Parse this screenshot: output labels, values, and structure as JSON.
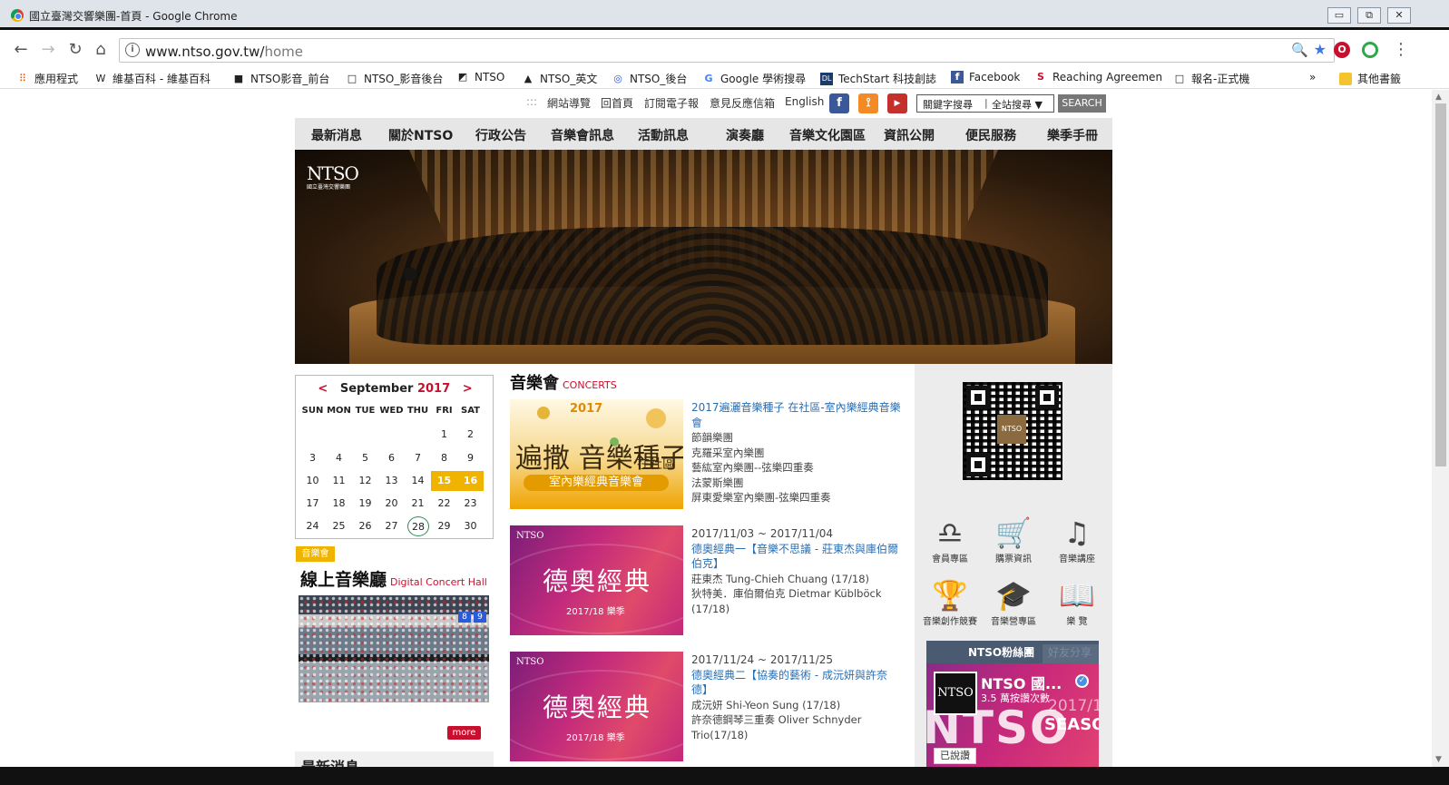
{
  "window": {
    "title": "國立臺灣交響樂團-首頁 - Google Chrome",
    "controls": {
      "minimize": "▭",
      "restore": "⧉",
      "close": "✕"
    }
  },
  "toolbar": {
    "back": "←",
    "forward": "→",
    "reload": "↻",
    "home": "⌂",
    "url_host": "www.ntso.gov.tw/",
    "url_path": "home",
    "info_icon": "i",
    "zoom_icon": "🔍",
    "star_icon": "★",
    "menu_icon": "⋮"
  },
  "bookmarks": {
    "apps": "應用程式",
    "items": [
      {
        "icon": "W",
        "label": "維基百科 - 維基百科"
      },
      {
        "icon": "■",
        "label": "NTSO影音_前台"
      },
      {
        "icon": "□",
        "label": "NTSO_影音後台"
      },
      {
        "icon": "◩",
        "label": "NTSO"
      },
      {
        "icon": "▲",
        "label": "NTSO_英文"
      },
      {
        "icon": "◎",
        "label": "NTSO_後台"
      },
      {
        "icon": "G",
        "label": "Google 學術搜尋"
      },
      {
        "icon": "DL",
        "label": "TechStart 科技創誌"
      },
      {
        "icon": "f",
        "label": "Facebook"
      },
      {
        "icon": "S",
        "label": "Reaching Agreemen"
      },
      {
        "icon": "□",
        "label": "報名-正式機"
      }
    ],
    "overflow": "»",
    "other": "其他書籤"
  },
  "site": {
    "util_links": [
      "網站導覽",
      "回首頁",
      "訂閱電子報",
      "意見反應信箱",
      "English"
    ],
    "util_sep": ":::",
    "search_scope_left": "關鍵字搜尋",
    "search_scope_right": "全站搜尋 ▼",
    "search_button": "SEARCH",
    "nav": [
      "最新消息",
      "關於NTSO",
      "行政公告",
      "音樂會訊息",
      "活動訊息",
      "演奏廳",
      "音樂文化園區",
      "資訊公開",
      "便民服務",
      "樂季手冊"
    ],
    "hero_logo": "NTSO",
    "hero_logo_sub": "國立臺灣交響樂團"
  },
  "calendar": {
    "prev": "<",
    "month": "September",
    "year": "2017",
    "next": ">",
    "weekdays": [
      "SUN",
      "MON",
      "TUE",
      "WED",
      "THU",
      "FRI",
      "SAT"
    ],
    "weeks": [
      [
        "",
        "",
        "",
        "",
        "",
        "1",
        "2"
      ],
      [
        "3",
        "4",
        "5",
        "6",
        "7",
        "8",
        "9"
      ],
      [
        "10",
        "11",
        "12",
        "13",
        "14",
        "15",
        "16"
      ],
      [
        "17",
        "18",
        "19",
        "20",
        "21",
        "22",
        "23"
      ],
      [
        "24",
        "25",
        "26",
        "27",
        "28",
        "29",
        "30"
      ]
    ],
    "event_days": [
      "15",
      "16"
    ],
    "today": "28"
  },
  "online": {
    "badge": "音樂會",
    "title": "線上音樂廳",
    "title_en": "Digital Concert Hall",
    "more": "more",
    "screen1": "8",
    "screen2": "9"
  },
  "news_strip": "最新消息",
  "concerts": {
    "title": "音樂會",
    "title_en": "CONCERTS",
    "items": [
      {
        "title": "2017遍灑音樂種子 在社區-室內樂經典音樂會",
        "lines": [
          "節韻樂團",
          "克羅采室內樂團",
          "藝紘室內樂團--弦樂四重奏",
          "法蒙斯樂團",
          "屏東愛樂室內樂團-弦樂四重奏"
        ],
        "image": {
          "top": "2017",
          "main": "遍撒 音樂種子",
          "side": "在社區",
          "banner": "室內樂經典音樂會"
        }
      },
      {
        "date": "2017/11/03 ~ 2017/11/04",
        "title": "德奧經典一【音樂不思議 - 莊東杰與庫伯爾伯克】",
        "lines": [
          "莊東杰 Tung-Chieh Chuang (17/18)",
          "狄特美．庫伯爾伯克 Dietmar Küblböck (17/18)"
        ],
        "image": {
          "brand": "NTSO",
          "main": "德奧經典",
          "season": "2017/18 樂季"
        }
      },
      {
        "date": "2017/11/24 ~ 2017/11/25",
        "title": "德奧經典二【協奏的藝術 - 成沅妍與許奈德】",
        "lines": [
          "成沅妍 Shi-Yeon Sung (17/18)",
          "許奈德鋼琴三重奏 Oliver Schnyder Trio(17/18)"
        ],
        "image": {
          "brand": "NTSO",
          "main": "德奧經典",
          "season": "2017/18 樂季"
        }
      }
    ]
  },
  "services": [
    {
      "icon": "members-icon",
      "glyph": "♎",
      "label": "會員專區"
    },
    {
      "icon": "cart-icon",
      "glyph": "🛒",
      "label": "購票資訊"
    },
    {
      "icon": "music-note-icon",
      "glyph": "♫",
      "label": "音樂講座"
    },
    {
      "icon": "trophy-icon",
      "glyph": "🏆",
      "label": "音樂創作競賽"
    },
    {
      "icon": "music-camp-icon",
      "glyph": "🎓",
      "label": "音樂營專區"
    },
    {
      "icon": "book-icon",
      "glyph": "📖",
      "label": "樂 覽"
    }
  ],
  "qr_center": "NTSO",
  "facebook": {
    "tab_fans": "NTSO粉絲團",
    "tab_share": "好友分享",
    "page_name": "NTSO 國...",
    "likes": "3.5 萬按讚次數",
    "cover_text": "NTSO",
    "cover_year": "2017/1",
    "cover_season": "SEASO",
    "liked_button": "已說讚",
    "pic_text": "NTSO"
  },
  "colors": {
    "accent_red": "#c8102e",
    "event_yellow": "#f0b400",
    "link_blue": "#2a6fb3"
  }
}
